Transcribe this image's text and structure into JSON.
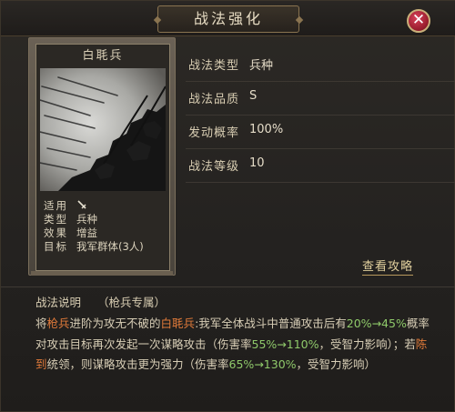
{
  "dialog": {
    "title": "战法强化",
    "close_label": "✕"
  },
  "card": {
    "name": "白毦兵",
    "meta": [
      {
        "label": "适用",
        "value": ""
      },
      {
        "label": "类型",
        "value": "兵种"
      },
      {
        "label": "效果",
        "value": "增益"
      },
      {
        "label": "目标",
        "value": "我军群体(3人)"
      }
    ]
  },
  "attributes": [
    {
      "label": "战法类型",
      "value": "兵种"
    },
    {
      "label": "战法品质",
      "value": "S"
    },
    {
      "label": "发动概率",
      "value": "100%"
    },
    {
      "label": "战法等级",
      "value": "10"
    }
  ],
  "guide_link": "查看攻略",
  "description": {
    "heading": "战法说明",
    "tag": "（枪兵专属）",
    "segments": [
      {
        "text": "将",
        "color": "normal"
      },
      {
        "text": "枪兵",
        "color": "orange"
      },
      {
        "text": "进阶为攻无不破的",
        "color": "normal"
      },
      {
        "text": "白毦兵",
        "color": "orange"
      },
      {
        "text": ":我军全体战斗中普通攻击后有",
        "color": "normal"
      },
      {
        "text": "20%→45%",
        "color": "green"
      },
      {
        "text": "概率对攻击目标再次发起一次谋略攻击（伤害率",
        "color": "normal"
      },
      {
        "text": "55%→110%",
        "color": "green"
      },
      {
        "text": "，受智力影响）；若",
        "color": "normal"
      },
      {
        "text": "陈到",
        "color": "orange"
      },
      {
        "text": "统领，则谋略攻击更为强力（伤害率",
        "color": "normal"
      },
      {
        "text": "65%→130%",
        "color": "green"
      },
      {
        "text": "，受智力影响）",
        "color": "normal"
      }
    ]
  },
  "colors": {
    "accent_orange": "#e07a3a",
    "accent_green": "#8fc96a",
    "close_red": "#b8283c"
  },
  "icons": [
    "close-icon",
    "sword-icon"
  ]
}
